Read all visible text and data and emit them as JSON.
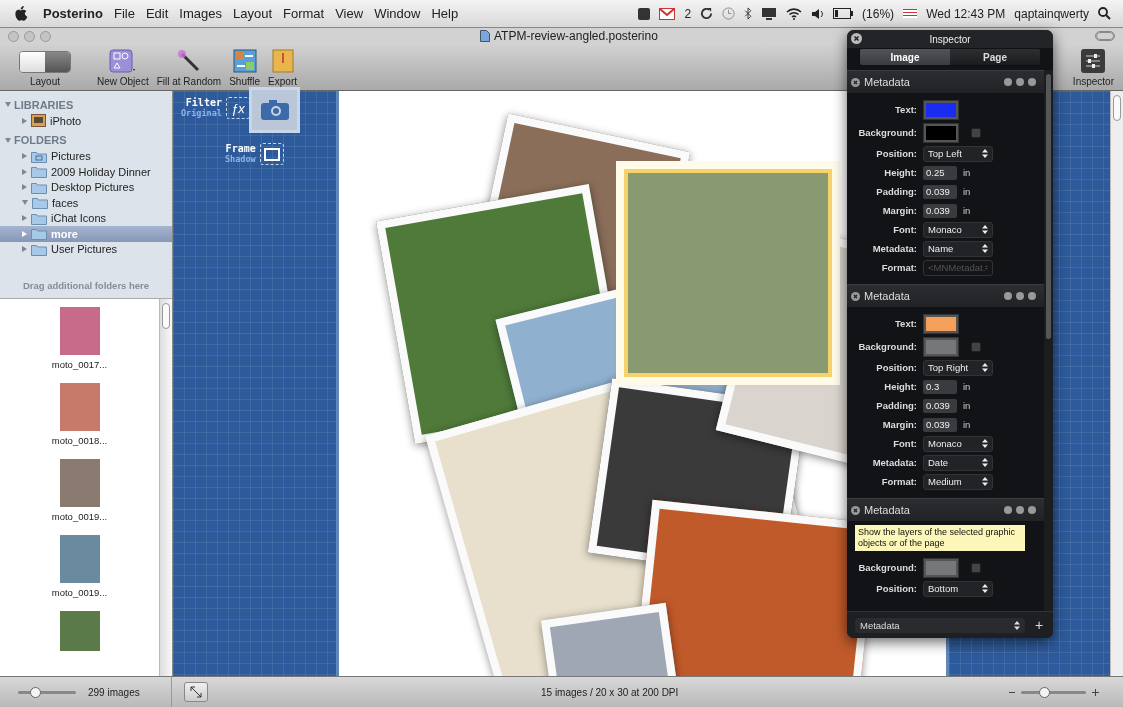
{
  "menubar": {
    "app": "Posterino",
    "menus": [
      "File",
      "Edit",
      "Images",
      "Layout",
      "Format",
      "View",
      "Window",
      "Help"
    ],
    "mail_count": "2",
    "battery": "(16%)",
    "clock": "Wed 12:43 PM",
    "user": "qaptainqwerty"
  },
  "window": {
    "title": "ATPM-review-angled.posterino"
  },
  "toolbar": [
    {
      "label": "Layout",
      "kind": "layout"
    },
    {
      "label": "New Object",
      "kind": "new-object"
    },
    {
      "label": "Fill at Random",
      "kind": "fill"
    },
    {
      "label": "Shuffle",
      "kind": "shuffle"
    },
    {
      "label": "Export",
      "kind": "export"
    }
  ],
  "inspector_button": {
    "label": "Inspector"
  },
  "sidebar": {
    "sections": [
      {
        "title": "LIBRARIES",
        "expanded": true,
        "items": [
          {
            "label": "iPhoto",
            "kind": "iphoto",
            "expanded": false,
            "selected": false
          }
        ]
      },
      {
        "title": "FOLDERS",
        "expanded": true,
        "items": [
          {
            "label": "Pictures",
            "kind": "pictures",
            "expanded": false,
            "selected": false
          },
          {
            "label": "2009 Holiday Dinner",
            "kind": "folder",
            "expanded": false,
            "selected": false
          },
          {
            "label": "Desktop Pictures",
            "kind": "folder",
            "expanded": false,
            "selected": false
          },
          {
            "label": "faces",
            "kind": "folder",
            "expanded": true,
            "selected": false
          },
          {
            "label": "iChat Icons",
            "kind": "folder",
            "expanded": false,
            "selected": false
          },
          {
            "label": "more",
            "kind": "folder",
            "expanded": false,
            "selected": true
          },
          {
            "label": "User Pictures",
            "kind": "folder",
            "expanded": false,
            "selected": false
          }
        ]
      }
    ],
    "hint": "Drag additional folders here"
  },
  "thumbnails": [
    {
      "label": "moto_0017..."
    },
    {
      "label": "moto_0018..."
    },
    {
      "label": "moto_0019..."
    },
    {
      "label": "moto_0019..."
    }
  ],
  "blueprint": {
    "nodes": [
      {
        "title": "Filter",
        "subtitle": "Original",
        "kind": "filter",
        "icon": "ƒx"
      },
      {
        "title": "Frame",
        "subtitle": "Shadow",
        "kind": "frame"
      }
    ]
  },
  "inspector": {
    "title": "Inspector",
    "tabs": [
      {
        "label": "Image",
        "selected": true
      },
      {
        "label": "Page",
        "selected": false
      }
    ],
    "sections": [
      {
        "title": "Metadata",
        "rows": [
          {
            "label": "Text:",
            "kind": "color",
            "color": "#1a2cf0"
          },
          {
            "label": "Background:",
            "kind": "color",
            "color": "#000000",
            "checked": false
          },
          {
            "label": "Position:",
            "kind": "select",
            "value": "Top Left",
            "disabled": false
          },
          {
            "label": "Height:",
            "kind": "field",
            "value": "0.25",
            "unit": "in"
          },
          {
            "label": "Padding:",
            "kind": "field",
            "value": "0.039",
            "unit": "in"
          },
          {
            "label": "Margin:",
            "kind": "field",
            "value": "0.039",
            "unit": "in"
          },
          {
            "label": "Font:",
            "kind": "select",
            "value": "Monaco",
            "disabled": false
          },
          {
            "label": "Metadata:",
            "kind": "select",
            "value": "Name",
            "disabled": false
          },
          {
            "label": "Format:",
            "kind": "select",
            "value": "<MNMetadat.",
            "disabled": true
          }
        ]
      },
      {
        "title": "Metadata",
        "rows": [
          {
            "label": "Text:",
            "kind": "color",
            "color": "#f5a05a"
          },
          {
            "label": "Background:",
            "kind": "color",
            "color": "#75777b",
            "checked": false
          },
          {
            "label": "Position:",
            "kind": "select",
            "value": "Top Right",
            "disabled": false
          },
          {
            "label": "Height:",
            "kind": "field",
            "value": "0.3",
            "unit": "in"
          },
          {
            "label": "Padding:",
            "kind": "field",
            "value": "0.039",
            "unit": "in"
          },
          {
            "label": "Margin:",
            "kind": "field",
            "value": "0.039",
            "unit": "in"
          },
          {
            "label": "Font:",
            "kind": "select",
            "value": "Monaco",
            "disabled": false
          },
          {
            "label": "Metadata:",
            "kind": "select",
            "value": "Date",
            "disabled": false
          },
          {
            "label": "Format:",
            "kind": "select",
            "value": "Medium",
            "disabled": false
          }
        ]
      },
      {
        "title": "Metadata",
        "tooltip": "Show the layers of the selected graphic objects or of the page",
        "rows": [
          {
            "label": "Background:",
            "kind": "color",
            "color": "#75777b",
            "checked": false
          },
          {
            "label": "Position:",
            "kind": "select",
            "value": "Bottom",
            "disabled": false
          }
        ]
      }
    ],
    "footer_select": "Metadata",
    "add": "+"
  },
  "status_bar": {
    "thumb_size": {
      "level": 0.3
    },
    "count": "299 images",
    "info": "15 images / 20 x 30 at 200 DPI",
    "zoom": {
      "level": 0.35
    }
  }
}
